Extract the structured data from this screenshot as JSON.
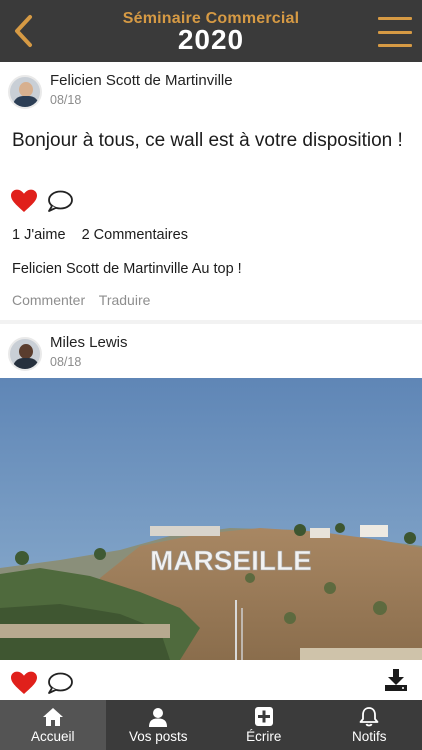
{
  "header": {
    "title": "Séminaire Commercial",
    "year": "2020",
    "accent_color": "#d69a44",
    "back_icon": "chevron-left-icon",
    "menu_icon": "hamburger-menu-icon"
  },
  "posts": [
    {
      "author": "Felicien Scott de Martinville",
      "date": "08/18",
      "text": "Bonjour à tous, ce wall est à votre disposition !",
      "likes_label": "1 J'aime",
      "comments_label": "2 Commentaires",
      "comment": {
        "author": "Felicien Scott de Martinville",
        "text": "Au top !"
      },
      "comment_link": "Commenter",
      "translate_link": "Traduire",
      "liked": true
    },
    {
      "author": "Miles Lewis",
      "date": "08/18",
      "image_caption_sign": "MARSEILLE",
      "liked": true
    }
  ],
  "tabbar": {
    "tabs": [
      {
        "label": "Accueil",
        "icon": "home-icon",
        "active": true
      },
      {
        "label": "Vos posts",
        "icon": "user-icon",
        "active": false
      },
      {
        "label": "Écrire",
        "icon": "plus-square-icon",
        "active": false
      },
      {
        "label": "Notifs",
        "icon": "bell-icon",
        "active": false
      }
    ]
  },
  "colors": {
    "header_bg": "#3a3a3a",
    "like_red": "#e0201b",
    "tabbar_bg": "#3b3b3b",
    "tab_active_bg": "#545454"
  }
}
